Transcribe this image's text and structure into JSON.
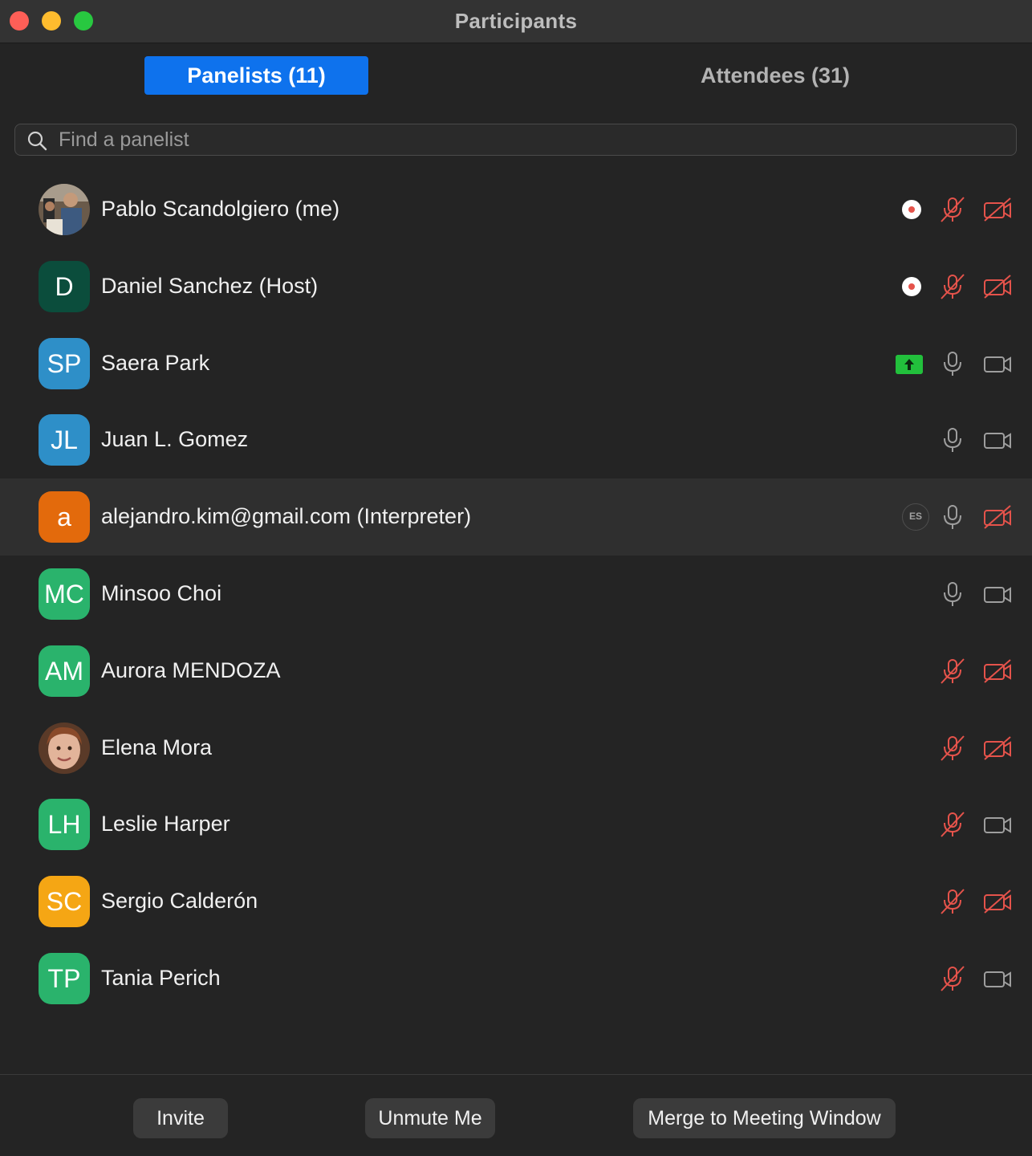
{
  "window": {
    "title": "Participants"
  },
  "tabs": {
    "panelists": "Panelists (11)",
    "attendees": "Attendees (31)"
  },
  "search": {
    "placeholder": "Find a panelist"
  },
  "colors": {
    "tab_active": "#0e72ed",
    "muted_red": "#e5534b",
    "icon_gray": "#9e9e9e",
    "share_green": "#22c03c"
  },
  "participants": [
    {
      "name": "Pablo Scandolgiero (me)",
      "avatar": "photo-avatar",
      "status_icon": "record-icon",
      "mic": "muted",
      "video": "off"
    },
    {
      "name": "Daniel Sanchez (Host)",
      "initials": "D",
      "avatar_color": "#0b4d3c",
      "status_icon": "record-icon",
      "mic": "muted",
      "video": "off"
    },
    {
      "name": "Saera Park",
      "initials": "SP",
      "avatar_color": "#2e8fc8",
      "status_icon": "share-screen-icon",
      "mic": "on",
      "video": "on"
    },
    {
      "name": "Juan L. Gomez",
      "initials": "JL",
      "avatar_color": "#2e8fc8",
      "mic": "on",
      "video": "on"
    },
    {
      "name": "alejandro.kim@gmail.com (Interpreter)",
      "initials": "a",
      "avatar_color": "#e36a0c",
      "language": "ES",
      "mic": "on",
      "video": "off"
    },
    {
      "name": "Minsoo Choi",
      "initials": "MC",
      "avatar_color": "#2ab36c",
      "mic": "on",
      "video": "on"
    },
    {
      "name": "Aurora MENDOZA",
      "initials": "AM",
      "avatar_color": "#2ab36c",
      "mic": "muted",
      "video": "off"
    },
    {
      "name": "Elena Mora",
      "avatar": "photo-avatar",
      "mic": "muted",
      "video": "off"
    },
    {
      "name": "Leslie Harper",
      "initials": "LH",
      "avatar_color": "#2ab36c",
      "mic": "muted",
      "video": "on"
    },
    {
      "name": "Sergio Calderón",
      "initials": "SC",
      "avatar_color": "#f5a614",
      "mic": "muted",
      "video": "off"
    },
    {
      "name": "Tania Perich",
      "initials": "TP",
      "avatar_color": "#2ab36c",
      "mic": "muted",
      "video": "on"
    }
  ],
  "footer": {
    "invite": "Invite",
    "unmute": "Unmute Me",
    "merge": "Merge to Meeting Window"
  }
}
